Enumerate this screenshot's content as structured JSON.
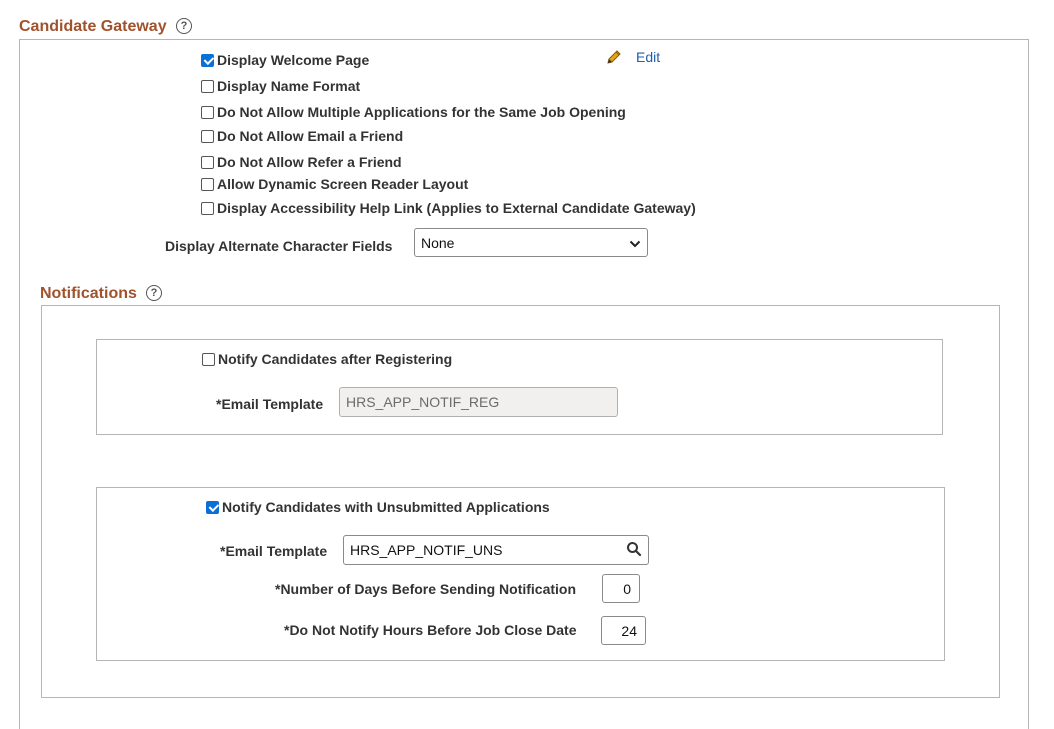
{
  "candidate_gateway": {
    "title": "Candidate Gateway",
    "help_glyph": "?",
    "edit_label": "Edit",
    "options": [
      {
        "label": "Display Welcome Page",
        "checked": true
      },
      {
        "label": "Display Name Format",
        "checked": false
      },
      {
        "label": "Do Not Allow Multiple Applications for the Same Job Opening",
        "checked": false
      },
      {
        "label": "Do Not Allow Email a Friend",
        "checked": false
      },
      {
        "label": "Do Not Allow Refer a Friend",
        "checked": false
      },
      {
        "label": "Allow Dynamic Screen Reader Layout",
        "checked": false
      },
      {
        "label": "Display Accessibility Help Link (Applies to External Candidate Gateway)",
        "checked": false
      }
    ],
    "alt_char_label": "Display Alternate Character Fields",
    "alt_char_value": "None"
  },
  "notifications": {
    "title": "Notifications",
    "help_glyph": "?",
    "registering": {
      "label": "Notify Candidates after Registering",
      "checked": false,
      "template_label": "*Email Template",
      "template_value": "HRS_APP_NOTIF_REG"
    },
    "unsubmitted": {
      "label": "Notify Candidates with Unsubmitted Applications",
      "checked": true,
      "template_label": "*Email Template",
      "template_value": "HRS_APP_NOTIF_UNS",
      "days_label": "*Number of Days Before Sending Notification",
      "days_value": "0",
      "hours_label": "*Do Not Notify Hours Before Job Close Date",
      "hours_value": "24"
    }
  },
  "icons": {
    "pencil": "pencil-icon",
    "search": "search-icon",
    "dropdown": "chevron-down-icon"
  },
  "colors": {
    "section_title": "#a0522d",
    "link": "#1f5fa8",
    "checkbox_checked": "#0b6fd6"
  }
}
